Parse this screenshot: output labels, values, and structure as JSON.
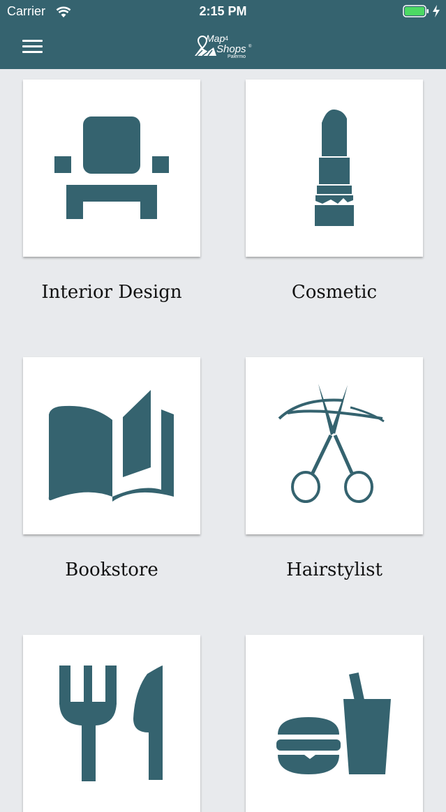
{
  "status_bar": {
    "carrier": "Carrier",
    "time": "2:15 PM"
  },
  "header": {
    "logo_text": "Map4Shops Palermo",
    "menu_icon": "hamburger-menu-icon"
  },
  "colors": {
    "accent": "#35636f",
    "background": "#e8eaed",
    "card": "#ffffff"
  },
  "categories": [
    {
      "label": "Interior Design",
      "icon": "armchair-icon"
    },
    {
      "label": "Cosmetic",
      "icon": "lipstick-icon"
    },
    {
      "label": "Bookstore",
      "icon": "open-book-icon"
    },
    {
      "label": "Hairstylist",
      "icon": "scissors-icon"
    },
    {
      "label": "",
      "icon": "fork-knife-icon"
    },
    {
      "label": "",
      "icon": "burger-drink-icon"
    }
  ]
}
